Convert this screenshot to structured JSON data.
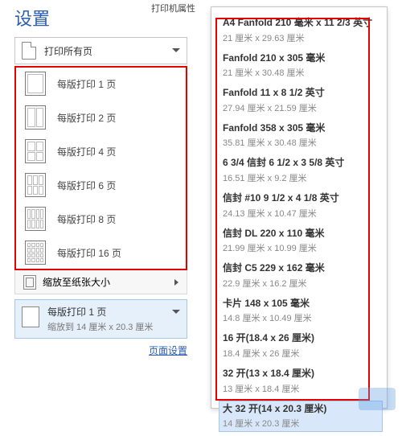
{
  "partial_top": "打印机属性",
  "settings_title": "设置",
  "print_all": {
    "label": "打印所有页"
  },
  "per_page": {
    "items": [
      {
        "label": "每版打印 1 页",
        "grid": "g1x1",
        "cells": 1
      },
      {
        "label": "每版打印 2 页",
        "grid": "g1x2",
        "cells": 2
      },
      {
        "label": "每版打印 4 页",
        "grid": "g2x2",
        "cells": 4
      },
      {
        "label": "每版打印 6 页",
        "grid": "g2x3",
        "cells": 6
      },
      {
        "label": "每版打印 8 页",
        "grid": "g2x4",
        "cells": 8
      },
      {
        "label": "每版打印 16 页",
        "grid": "g4x4",
        "cells": 16
      }
    ],
    "scale_label": "缩放至纸张大小"
  },
  "bottom": {
    "title": "每版打印 1 页",
    "sub": "缩放到 14 厘米 x 20.3 厘米"
  },
  "page_setup_link": "页面设置",
  "papers": [
    {
      "title": "A4 Fanfold 210 毫米 x 11 2/3 英寸",
      "sub": "21 厘米 x 29.63 厘米"
    },
    {
      "title": "Fanfold 210 x 305 毫米",
      "sub": "21 厘米 x 30.48 厘米"
    },
    {
      "title": "Fanfold 11 x 8 1/2 英寸",
      "sub": "27.94 厘米 x 21.59 厘米"
    },
    {
      "title": "Fanfold 358 x 305 毫米",
      "sub": "35.81 厘米 x 30.48 厘米"
    },
    {
      "title": "6 3/4 信封 6 1/2 x 3 5/8 英寸",
      "sub": "16.51 厘米 x 9.2 厘米"
    },
    {
      "title": "信封 #10 9 1/2 x 4 1/8 英寸",
      "sub": "24.13 厘米 x 10.47 厘米"
    },
    {
      "title": "信封 DL 220 x 110 毫米",
      "sub": "21.99 厘米 x 10.99 厘米"
    },
    {
      "title": "信封 C5 229 x 162 毫米",
      "sub": "22.9 厘米 x 16.2 厘米"
    },
    {
      "title": "卡片 148 x 105 毫米",
      "sub": "14.8 厘米 x 10.49 厘米"
    },
    {
      "title": "16 开(18.4 x 26 厘米)",
      "sub": "18.4 厘米 x 26 厘米"
    },
    {
      "title": "32 开(13 x 18.4 厘米)",
      "sub": "13 厘米 x 18.4 厘米"
    },
    {
      "title": "大 32 开(14 x 20.3 厘米)",
      "sub": "14 厘米 x 20.3 厘米",
      "highlight": true
    }
  ]
}
